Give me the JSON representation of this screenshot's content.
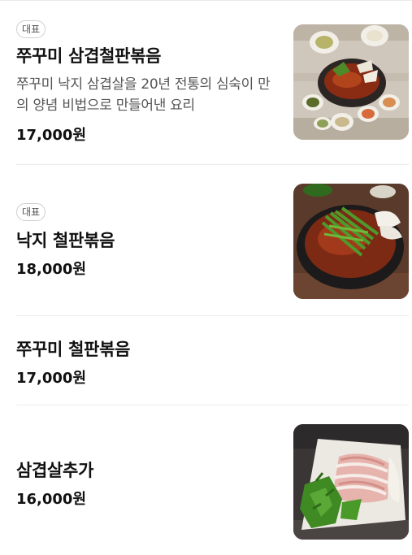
{
  "menu": {
    "items": [
      {
        "badge": "대표",
        "name": "쭈꾸미 삼겹철판볶음",
        "description": "쭈꾸미 낙지 삼겹살을 20년 전통의 심숙이 만의 양념 비법으로 만들어낸 요리",
        "price": "17,000원"
      },
      {
        "badge": "대표",
        "name": "낙지 철판볶음",
        "price": "18,000원"
      },
      {
        "name": "쭈꾸미 철판볶음",
        "price": "17,000원"
      },
      {
        "name": "삼겹살추가",
        "price": "16,000원"
      }
    ]
  }
}
